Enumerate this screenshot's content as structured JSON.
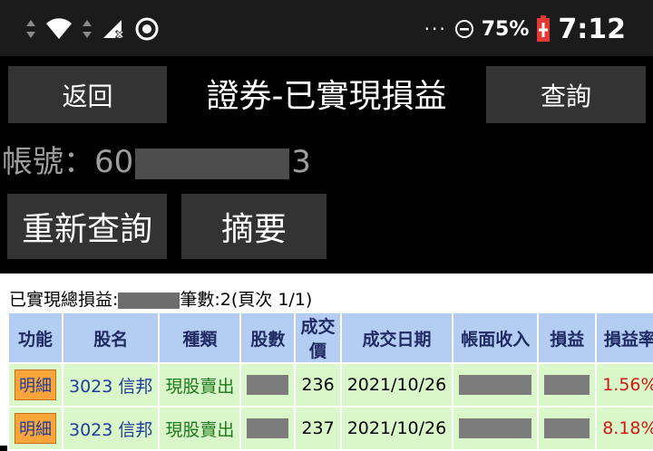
{
  "status": {
    "dots": "···",
    "battery_percent": "75%",
    "time": "7:12"
  },
  "header": {
    "back_label": "返回",
    "title": "證券-已實現損益",
    "query_label": "查詢"
  },
  "account": {
    "label": "帳號：",
    "prefix": "60",
    "suffix": "3"
  },
  "actions": {
    "refresh_label": "重新查詢",
    "summary_label": "摘要"
  },
  "totals": {
    "total_label": "已實現總損益:",
    "count_text": "筆數:2(頁次 1/1)"
  },
  "table": {
    "columns": [
      "功能",
      "股名",
      "種類",
      "股數",
      "成交價",
      "成交日期",
      "帳面收入",
      "損益",
      "損益率"
    ],
    "rows": [
      {
        "detail": "明細",
        "stock": "3023 信邦",
        "type": "現股賣出",
        "price": "236",
        "date": "2021/10/26",
        "rate": "1.56%"
      },
      {
        "detail": "明細",
        "stock": "3023 信邦",
        "type": "現股賣出",
        "price": "237",
        "date": "2021/10/26",
        "rate": "8.18%"
      }
    ]
  }
}
